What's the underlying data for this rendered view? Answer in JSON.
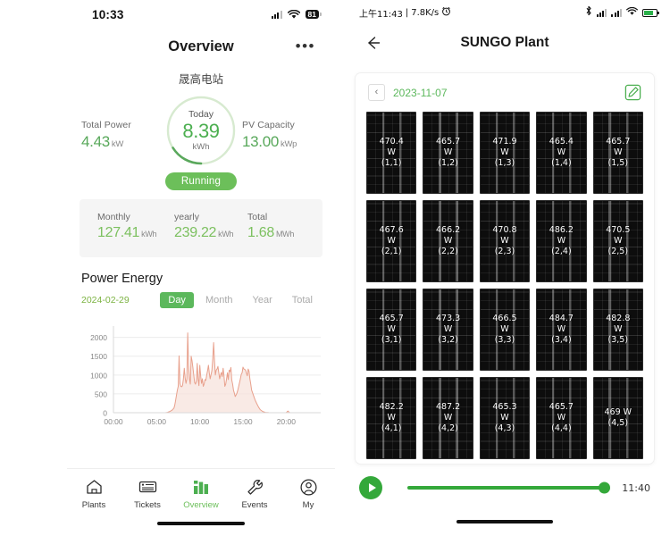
{
  "left_phone": {
    "status_bar": {
      "time": "10:33",
      "battery_pct": "81",
      "wifi_icon": "wifi-icon",
      "signal_icon": "signal-bars-icon"
    },
    "nav": {
      "title": "Overview",
      "more_icon": "more-dots-icon"
    },
    "plant_name": "晟高电站",
    "hero": {
      "left_kpi": {
        "label": "Total Power",
        "value": "4.43",
        "unit": "kW"
      },
      "gauge": {
        "caption": "Today",
        "value": "8.39",
        "unit": "kWh",
        "ring_color": "#cfe7c6",
        "arc_color": "#5aa85c",
        "value_color": "#4caf50"
      },
      "right_kpi": {
        "label": "PV Capacity",
        "value": "13.00",
        "unit": "kWp"
      },
      "status_pill": {
        "label": "Running",
        "color": "#6cbf5a"
      }
    },
    "totals": [
      {
        "label": "Monthly",
        "value": "127.41",
        "unit": "kWh"
      },
      {
        "label": "yearly",
        "value": "239.22",
        "unit": "kWh"
      },
      {
        "label": "Total",
        "value": "1.68",
        "unit": "MWh"
      }
    ],
    "power_energy": {
      "title": "Power Energy",
      "date": "2024-02-29",
      "ranges": [
        {
          "label": "Day",
          "active": true
        },
        {
          "label": "Month",
          "active": false
        },
        {
          "label": "Year",
          "active": false
        },
        {
          "label": "Total",
          "active": false
        }
      ]
    },
    "tabbar": [
      {
        "label": "Plants",
        "icon": "home-icon",
        "active": false
      },
      {
        "label": "Tickets",
        "icon": "ticket-icon",
        "active": false
      },
      {
        "label": "Overview",
        "icon": "bar-chart-icon",
        "active": true
      },
      {
        "label": "Events",
        "icon": "wrench-icon",
        "active": false
      },
      {
        "label": "My",
        "icon": "user-icon",
        "active": false
      }
    ]
  },
  "right_phone": {
    "status_bar": {
      "time": "上午11:43",
      "net_speed": "7.8K/s",
      "alarm_icon": "alarm-clock-icon",
      "bluetooth_icon": "bluetooth-icon",
      "signal_icon": "signal-bars-icon",
      "wifi_icon": "wifi-icon",
      "battery_icon": "battery-icon"
    },
    "nav": {
      "title": "SUNGO Plant",
      "back_icon": "arrow-left-icon"
    },
    "date_bar": {
      "prev_icon": "chevron-left-icon",
      "date": "2023-11-07",
      "edit_icon": "edit-pencil-icon"
    },
    "panel_unit": "W",
    "panels": [
      {
        "power": "470.4",
        "coord": "(1,1)"
      },
      {
        "power": "465.7",
        "coord": "(1,2)"
      },
      {
        "power": "471.9",
        "coord": "(1,3)"
      },
      {
        "power": "465.4",
        "coord": "(1,4)"
      },
      {
        "power": "465.7",
        "coord": "(1,5)"
      },
      {
        "power": "467.6",
        "coord": "(2,1)"
      },
      {
        "power": "466.2",
        "coord": "(2,2)"
      },
      {
        "power": "470.8",
        "coord": "(2,3)"
      },
      {
        "power": "486.2",
        "coord": "(2,4)"
      },
      {
        "power": "470.5",
        "coord": "(2,5)"
      },
      {
        "power": "465.7",
        "coord": "(3,1)"
      },
      {
        "power": "473.3",
        "coord": "(3,2)"
      },
      {
        "power": "466.5",
        "coord": "(3,3)"
      },
      {
        "power": "484.7",
        "coord": "(3,4)"
      },
      {
        "power": "482.8",
        "coord": "(3,5)"
      },
      {
        "power": "482.2",
        "coord": "(4,1)"
      },
      {
        "power": "487.2",
        "coord": "(4,2)"
      },
      {
        "power": "465.3",
        "coord": "(4,3)"
      },
      {
        "power": "465.7",
        "coord": "(4,4)"
      },
      {
        "power": "469",
        "coord": "(4,5)"
      }
    ],
    "player": {
      "play_icon": "play-icon",
      "time": "11:40",
      "progress_pct": 100,
      "accent": "#34a83a"
    }
  },
  "chart_data": {
    "type": "area",
    "title": "Power Energy",
    "xlabel": "",
    "ylabel": "",
    "date": "2024-02-29",
    "line_color": "#e8a08c",
    "fill_color": "#f7e1da",
    "ylim": [
      0,
      2300
    ],
    "yticks": [
      0,
      500,
      1000,
      1500,
      2000
    ],
    "xticks": [
      "00:00",
      "05:00",
      "10:00",
      "15:00",
      "20:00"
    ],
    "xlim_hours": [
      0,
      24
    ],
    "grid": true,
    "x": [
      0,
      0.5,
      1,
      1.5,
      2,
      2.5,
      3,
      3.5,
      4,
      4.5,
      5,
      5.5,
      6,
      6.25,
      6.5,
      6.75,
      7,
      7.1,
      7.2,
      7.3,
      7.4,
      7.5,
      7.6,
      7.7,
      7.8,
      7.9,
      8,
      8.1,
      8.2,
      8.3,
      8.4,
      8.5,
      8.6,
      8.7,
      8.8,
      8.9,
      9,
      9.1,
      9.2,
      9.3,
      9.4,
      9.5,
      9.6,
      9.7,
      9.8,
      9.9,
      10,
      10.1,
      10.2,
      10.3,
      10.4,
      10.5,
      10.6,
      10.7,
      10.8,
      10.9,
      11,
      11.1,
      11.2,
      11.3,
      11.4,
      11.5,
      11.6,
      11.7,
      11.8,
      11.9,
      12,
      12.1,
      12.2,
      12.3,
      12.4,
      12.5,
      12.6,
      12.7,
      12.8,
      12.9,
      13,
      13.1,
      13.2,
      13.3,
      13.4,
      13.5,
      13.6,
      13.7,
      13.8,
      13.9,
      14,
      14.1,
      14.2,
      14.3,
      14.4,
      14.5,
      14.6,
      14.7,
      14.8,
      14.9,
      15,
      15.1,
      15.2,
      15.3,
      15.4,
      15.5,
      15.6,
      15.7,
      15.8,
      15.9,
      16,
      16.2,
      16.4,
      16.6,
      16.8,
      17,
      17.3,
      17.6,
      18,
      19,
      20,
      20.2,
      20.4,
      21,
      22,
      23,
      24
    ],
    "y": [
      0,
      0,
      0,
      0,
      0,
      0,
      0,
      0,
      0,
      0,
      0,
      0,
      0,
      10,
      30,
      60,
      120,
      200,
      330,
      470,
      600,
      700,
      1510,
      780,
      700,
      690,
      720,
      900,
      1180,
      930,
      780,
      900,
      2120,
      1260,
      900,
      760,
      1500,
      1380,
      1200,
      1000,
      800,
      760,
      840,
      1310,
      900,
      720,
      1260,
      980,
      780,
      900,
      700,
      760,
      880,
      860,
      1000,
      1120,
      1260,
      1050,
      900,
      1010,
      1120,
      1430,
      1860,
      1380,
      1000,
      1130,
      1160,
      1230,
      1060,
      900,
      1000,
      1070,
      960,
      1180,
      980,
      700,
      760,
      900,
      1060,
      880,
      1130,
      1090,
      1200,
      870,
      760,
      600,
      520,
      430,
      470,
      520,
      600,
      700,
      800,
      900,
      1020,
      1060,
      1210,
      1160,
      1150,
      1130,
      1050,
      980,
      1160,
      1100,
      900,
      760,
      600,
      470,
      340,
      240,
      150,
      80,
      30,
      8,
      2,
      0,
      0,
      45,
      0,
      0,
      0,
      0,
      0
    ]
  }
}
